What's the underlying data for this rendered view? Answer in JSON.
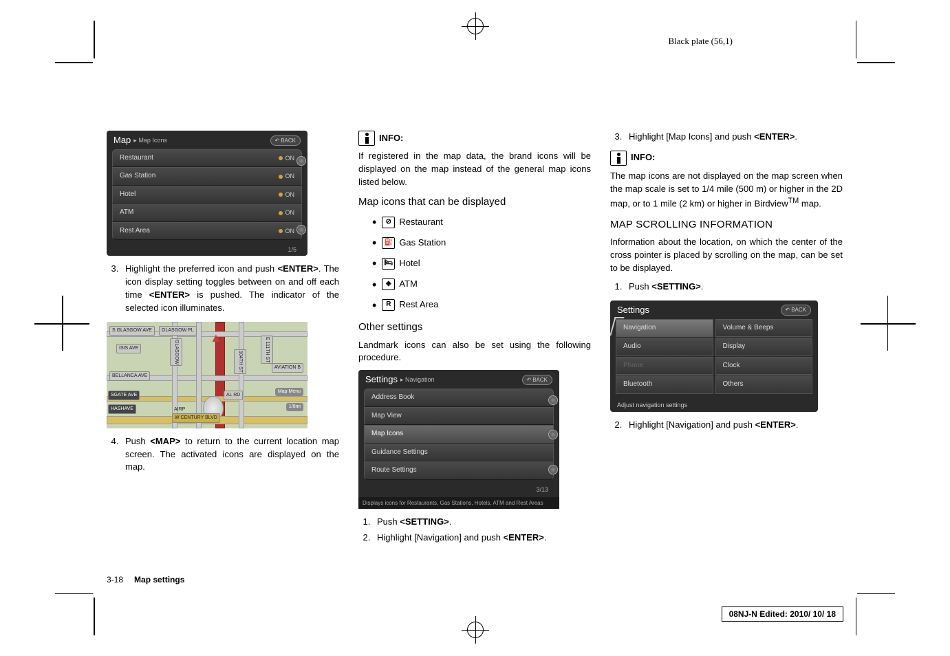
{
  "header": "Black plate (56,1)",
  "col1": {
    "screenshot1": {
      "title_main": "Map",
      "title_sub": "▸ Map Icons",
      "back": "BACK",
      "rows": [
        {
          "label": "Restaurant",
          "state": "ON"
        },
        {
          "label": "Gas Station",
          "state": "ON"
        },
        {
          "label": "Hotel",
          "state": "ON"
        },
        {
          "label": "ATM",
          "state": "ON"
        },
        {
          "label": "Rest Area",
          "state": "ON"
        }
      ],
      "pager": "1/5"
    },
    "step3": "Highlight the preferred icon and push <ENTER>. The icon display setting toggles between on and off each time <ENTER> is pushed. The indicator of the selected icon illuminates.",
    "map": {
      "labels": {
        "glasgow_ave": "S GLASGOW AVE",
        "glasgow_pl": "GLASGOW PL",
        "isis": "ISIS AVE",
        "bellanca": "BELLANCA AVE",
        "sgate": "SGATE AVE",
        "hashave": "HASHAVE",
        "aviation": "AVIATION B",
        "century": "W CENTURY BLVD",
        "alpo": "AL RD",
        "n111": "E 111TH ST",
        "n104": "104TH ST",
        "glas_w": "GLASGOW",
        "airp": "AIRP"
      },
      "map_menu": "Map Menu",
      "scale": "1/8mi"
    },
    "step4": "Push <MAP> to return to the current location map screen. The activated icons are displayed on the map."
  },
  "col2": {
    "info_label": "INFO:",
    "info_text": "If registered in the map data, the brand icons will be displayed on the map instead of the general map icons listed below.",
    "subhead1": "Map icons that can be displayed",
    "icons": [
      "Restaurant",
      "Gas Station",
      "Hotel",
      "ATM",
      "Rest Area"
    ],
    "glyphs": [
      "⊘",
      "⛽",
      "🛏",
      "◈",
      "R"
    ],
    "subhead2": "Other settings",
    "other_text": "Landmark icons can also be set using the following procedure.",
    "screenshot2": {
      "title_main": "Settings",
      "title_sub": "▸ Navigation",
      "back": "BACK",
      "rows": [
        "Address Book",
        "Map View",
        "Map Icons",
        "Guidance Settings",
        "Route Settings"
      ],
      "pager": "3/13",
      "caption": "Displays icons for Restaurants, Gas Stations, Hotels, ATM and Rest Areas"
    },
    "step1b": "Push <SETTING>.",
    "step2b": "Highlight [Navigation] and push <ENTER>."
  },
  "col3": {
    "step3c": "Highlight [Map Icons] and push <ENTER>.",
    "info_label": "INFO:",
    "info_text": "The map icons are not displayed on the map screen when the map scale is set to 1/4 mile (500 m) or higher in the 2D map, or to 1 mile (2 km) or higher in Birdview™ map.",
    "section": "MAP SCROLLING INFORMATION",
    "section_text": "Information about the location, on which the center of the cross pointer is placed by scrolling on the map, can be set to be displayed.",
    "step1d": "Push <SETTING>.",
    "screenshot3": {
      "title": "Settings",
      "back": "BACK",
      "cells_left": [
        "Navigation",
        "Audio",
        "Phone",
        "Bluetooth"
      ],
      "cells_right": [
        "Volume & Beeps",
        "Display",
        "Clock",
        "Others"
      ],
      "status": "Adjust navigation settings"
    },
    "step2d": "Highlight [Navigation] and push <ENTER>."
  },
  "footer": {
    "page": "3-18",
    "section": "Map settings",
    "edit": "08NJ-N Edited: 2010/ 10/ 18"
  }
}
